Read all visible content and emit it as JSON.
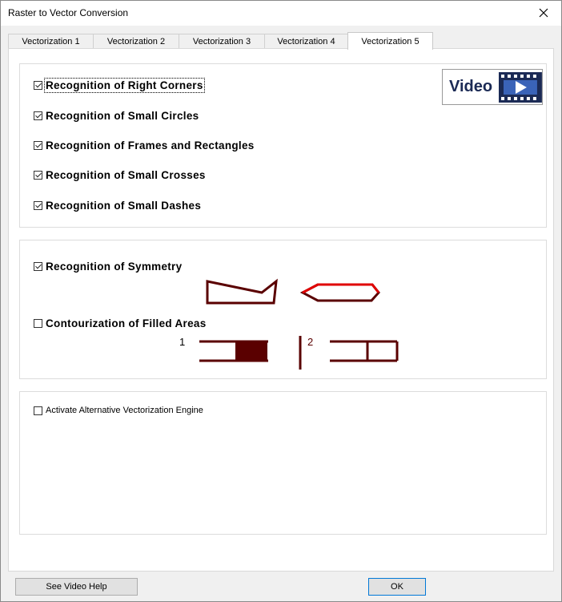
{
  "window": {
    "title": "Raster to Vector Conversion"
  },
  "tabs": [
    {
      "label": "Vectorization 1",
      "active": false
    },
    {
      "label": "Vectorization 2",
      "active": false
    },
    {
      "label": "Vectorization 3",
      "active": false
    },
    {
      "label": "Vectorization 4",
      "active": false
    },
    {
      "label": "Vectorization 5",
      "active": true
    }
  ],
  "group1": {
    "options": [
      {
        "label": "Recognition of Right Corners",
        "checked": true
      },
      {
        "label": "Recognition of Small Circles",
        "checked": true
      },
      {
        "label": "Recognition of Frames and Rectangles",
        "checked": true
      },
      {
        "label": "Recognition of Small Crosses",
        "checked": true
      },
      {
        "label": "Recognition of Small Dashes",
        "checked": true
      }
    ],
    "video_label": "Video"
  },
  "group2": {
    "symmetry_label": "Recognition of Symmetry",
    "symmetry_checked": true,
    "contour_label": "Contourization of Filled Areas",
    "contour_checked": false,
    "marker_1": "1",
    "marker_2": "2"
  },
  "group3": {
    "engine_label": "Activate Alternative Vectorization Engine",
    "engine_checked": false
  },
  "buttons": {
    "video_help": "See Video Help",
    "ok": "OK"
  },
  "colors": {
    "shape_dark": "#5a0000",
    "shape_red": "#e00000",
    "ok_border": "#0078d7"
  }
}
